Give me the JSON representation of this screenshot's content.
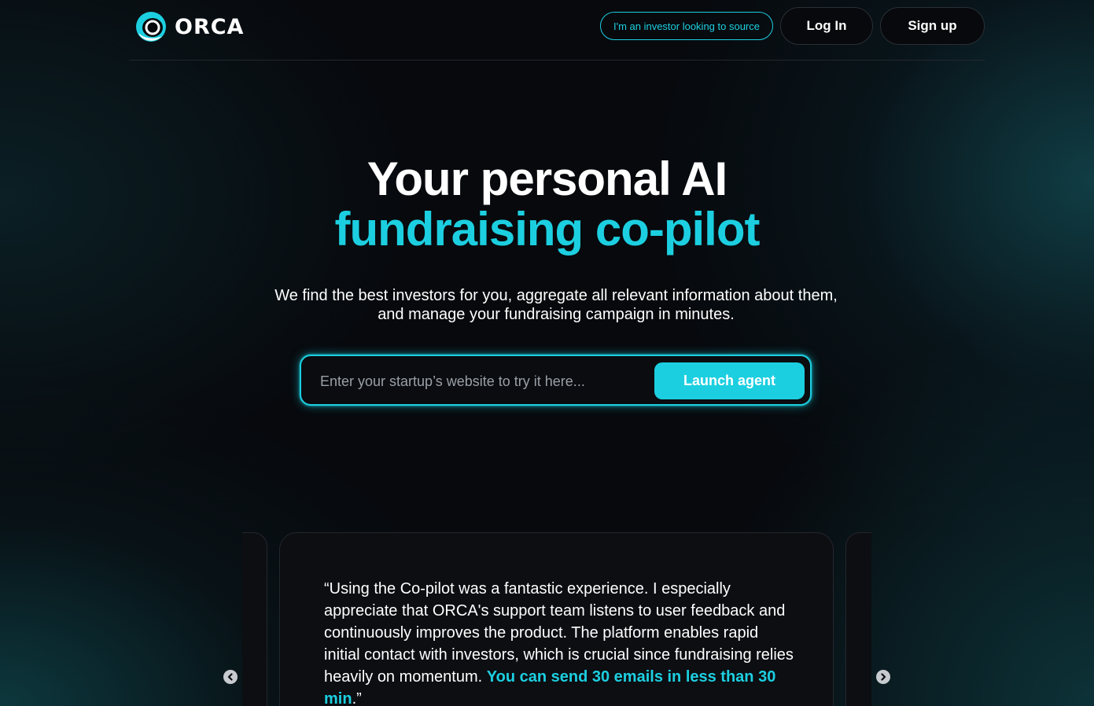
{
  "brand": {
    "name": "ORCA",
    "accent_color": "#1ccfe0",
    "background_color": "#07090d"
  },
  "nav": {
    "investor_label": "I'm an investor looking to source",
    "login_label": "Log In",
    "signup_label": "Sign up"
  },
  "hero": {
    "title_line1": "Your personal AI",
    "title_line2": "fundraising co-pilot",
    "subtitle": "We find the best investors for you, aggregate all relevant information about them, and manage your fundraising campaign in minutes."
  },
  "search": {
    "placeholder": "Enter your startup’s website to try it here...",
    "value": "",
    "button_label": "Launch agent"
  },
  "testimonial": {
    "quote_main": "“Using the Co-pilot was a fantastic experience. I especially appreciate that ORCA's support team listens to user feedback and continuously improves the product. The platform enables rapid initial contact with investors, which is crucial since fundraising relies heavily on momentum. ",
    "quote_highlight": "You can send 30 emails in less than 30 min",
    "quote_end": ".”"
  },
  "carousel": {
    "prev_icon": "chevron-left-icon",
    "next_icon": "chevron-right-icon"
  }
}
